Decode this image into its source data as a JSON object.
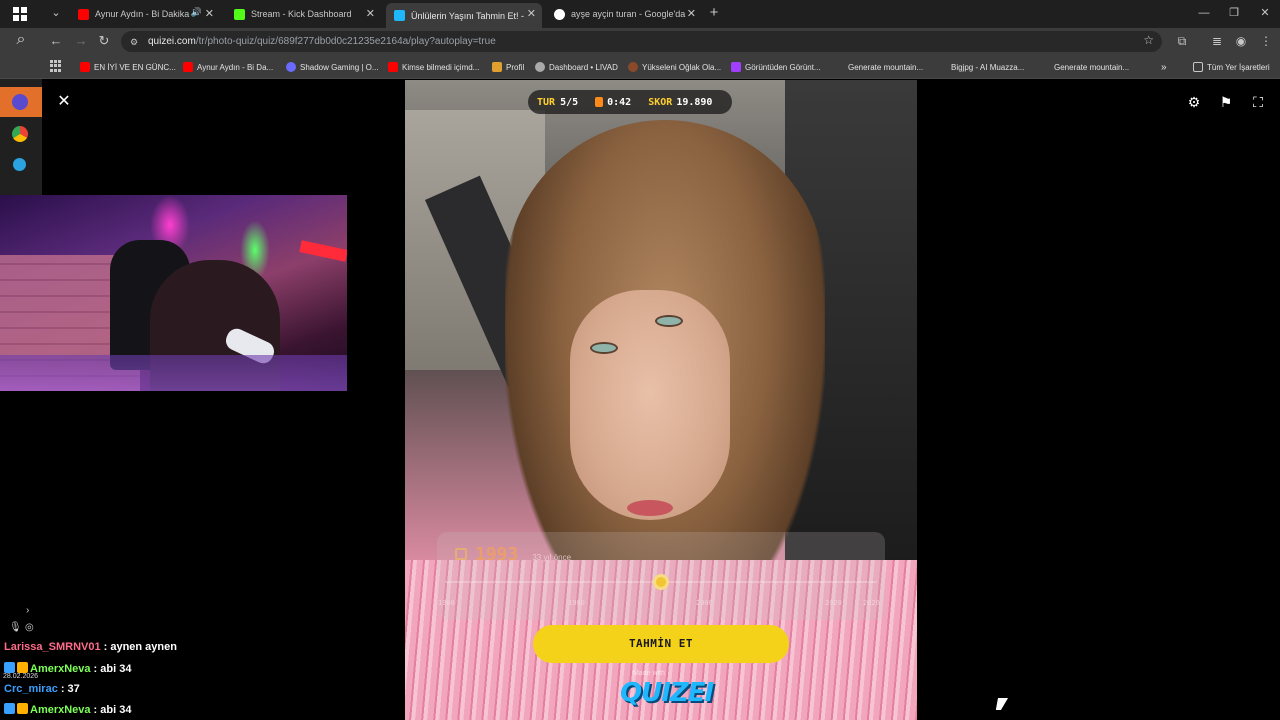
{
  "browser": {
    "tabs": [
      {
        "title": "Aynur Aydın - Bi Dakika - S",
        "favicon_color": "#ff0000",
        "playing_audio": true
      },
      {
        "title": "Stream - Kick Dashboard",
        "favicon_color": "#53fc18",
        "playing_audio": false
      },
      {
        "title": "Ünlülerin Yaşını Tahmin Et! - Qu",
        "favicon_color": "#1fb8ff",
        "playing_audio": false,
        "active": true
      },
      {
        "title": "ayşe ayçin turan - Google'da A",
        "favicon_color": "#ffffff",
        "playing_audio": false
      }
    ],
    "url": {
      "host": "quizei.com",
      "path": "/tr/photo-quiz/quiz/689f277db0d0c21235e2164a/play?autoplay=true"
    },
    "bookmarks": [
      {
        "label": "EN İYİ VE EN GÜNC...",
        "favicon_color": "#ff0000"
      },
      {
        "label": "Aynur Aydın - Bi Da...",
        "favicon_color": "#ff0000"
      },
      {
        "label": "Shadow Gaming | O...",
        "favicon_color": "#6a6aff"
      },
      {
        "label": "Kimse bilmedi içimd...",
        "favicon_color": "#ff0000"
      },
      {
        "label": "Profil",
        "favicon_color": "#e0a030"
      },
      {
        "label": "Dashboard • LIVAD",
        "favicon_color": "#aaaaaa"
      },
      {
        "label": "Yükseleni Oğlak Ola...",
        "favicon_color": "#8a4a2a"
      },
      {
        "label": "Görüntüden Görünt...",
        "favicon_color": "#a040ff"
      },
      {
        "label": "Generate mountain...",
        "favicon_color": ""
      },
      {
        "label": "Bigjpg - AI Muazza...",
        "favicon_color": ""
      },
      {
        "label": "Generate mountain...",
        "favicon_color": ""
      }
    ],
    "all_bookmarks_label": "Tüm Yer İşaretleri"
  },
  "game": {
    "round_label": "TUR",
    "round_value": "5/5",
    "timer_value": "0:42",
    "score_label": "SKOR",
    "score_value": "19.890",
    "year_value": "1993",
    "years_ago_text": "33 yıl önce",
    "slider_ticks": [
      "1960",
      "1980",
      "2000",
      "2020",
      "2026"
    ],
    "slider_position_fraction": 0.5,
    "guess_button_label": "TAHMİN ET",
    "made_with_text": "Made with",
    "brand_name": "QUIZEI",
    "accent_color": "#f5d21a"
  },
  "chat": {
    "date": "28.02.2026",
    "messages": [
      {
        "user": "Larissa_SMRNV01",
        "text": ": aynen aynen",
        "color": "#ff6b8a"
      },
      {
        "user": "AmerxNeva",
        "text": ": abi 34",
        "color": "#7dff5a"
      },
      {
        "user": "Crc_mirac",
        "text": ": 37",
        "color": "#3aa0ff"
      },
      {
        "user": "AmerxNeva",
        "text": ": abi 34",
        "color": "#7dff5a"
      }
    ]
  }
}
